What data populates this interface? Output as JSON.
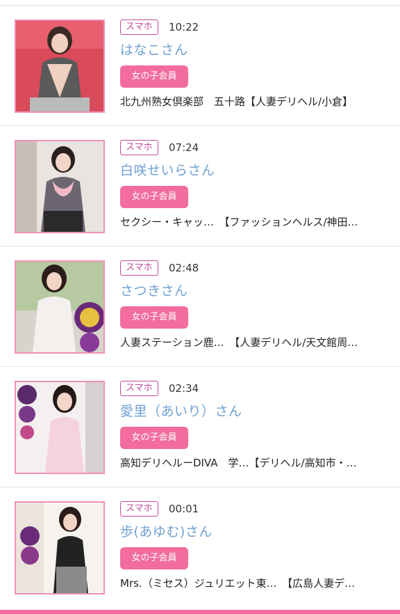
{
  "colors": {
    "badge_bg": "#f26c9d",
    "device_border": "#c24a9a",
    "name_text": "#6fa0d2",
    "thumb_border": "#f28fb6"
  },
  "entries": [
    {
      "device": "スマホ",
      "time": "10:22",
      "name": "はなこさん",
      "badge": "女の子会員",
      "shop": "北九州熟女倶楽部　五十路【人妻デリヘル/小倉】"
    },
    {
      "device": "スマホ",
      "time": "07:24",
      "name": "白咲せいらさん",
      "badge": "女の子会員",
      "shop": "セクシー・キャッ…　【ファッションヘルス/神田…"
    },
    {
      "device": "スマホ",
      "time": "02:48",
      "name": "さつきさん",
      "badge": "女の子会員",
      "shop": "人妻ステーション鹿…　【人妻デリヘル/天文館周…"
    },
    {
      "device": "スマホ",
      "time": "02:34",
      "name": "愛里（あいり）さん",
      "badge": "女の子会員",
      "shop": "高知デリヘルーDIVA　学…【デリヘル/高知市・…"
    },
    {
      "device": "スマホ",
      "time": "00:01",
      "name": "歩(あゆむ)さん",
      "badge": "女の子会員",
      "shop": "Mrs.（ミセス）ジュリエット東…　【広島人妻デ…"
    }
  ]
}
